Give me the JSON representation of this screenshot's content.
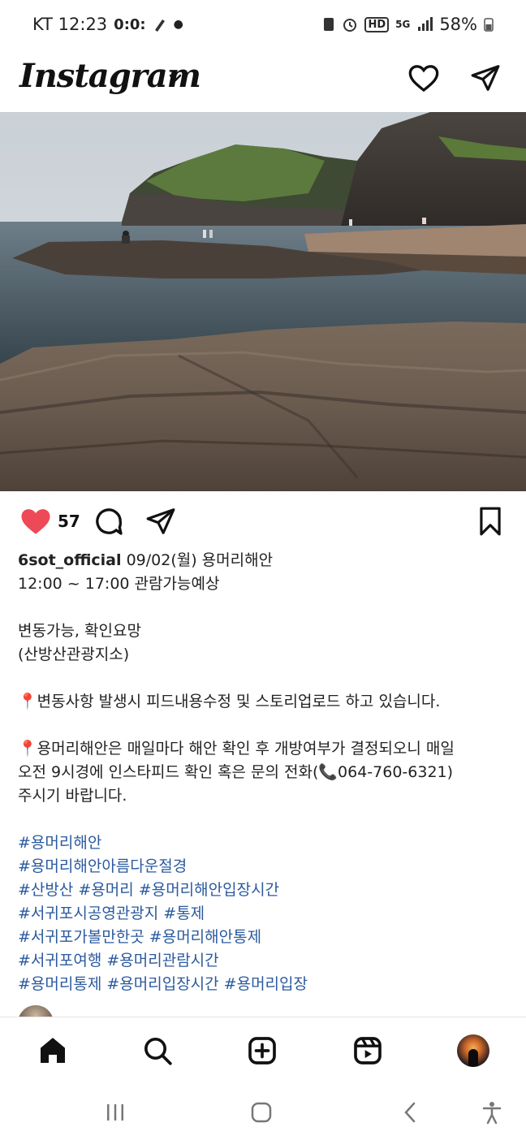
{
  "status_bar": {
    "carrier_time": "KT 12:23",
    "extra_icons": "0:0: ",
    "network": "5G",
    "battery": "58%"
  },
  "header": {
    "logo_text": "Instagram"
  },
  "post": {
    "like_count": "57",
    "caption_lines": [
      {
        "username": "6sot_official",
        "text": " 09/02(월) 용머리해안"
      },
      {
        "text": "12:00 ~ 17:00 관람가능예상"
      },
      {
        "text": ""
      },
      {
        "text": "변동가능, 확인요망"
      },
      {
        "text": "(산방산관광지소)"
      },
      {
        "text": ""
      },
      {
        "text": "📍변동사항 발생시 피드내용수정 및 스토리업로드 하고 있습니다."
      },
      {
        "text": ""
      },
      {
        "text": "📍용머리해안은 매일마다 해안 확인 후 개방여부가 결정되오니 매일"
      },
      {
        "text": "오전 9시경에 인스타피드 확인 혹은 문의 전화(📞064-760-6321)"
      },
      {
        "text": "주시기 바랍니다."
      },
      {
        "text": ""
      }
    ],
    "hashtag_lines": [
      "#용머리해안",
      "#용머리해안아름다운절경",
      "#산방산 #용머리 #용머리해안입장시간",
      "#서귀포시공영관광지 #통제",
      "#서귀포가볼만한곳 #용머리해안통제",
      "#서귀포여행 #용머리관람시간",
      "#용머리통제 #용머리입장시간 #용머리입장"
    ]
  },
  "colors": {
    "like_red": "#ed4956",
    "hashtag_blue": "#2b5a9e"
  },
  "icons": [
    "heart-icon",
    "send-icon",
    "comment-icon",
    "bookmark-icon",
    "home-icon",
    "search-icon",
    "create-icon",
    "reels-icon",
    "recents-icon",
    "home-circle-icon",
    "back-icon",
    "accessibility-icon"
  ]
}
